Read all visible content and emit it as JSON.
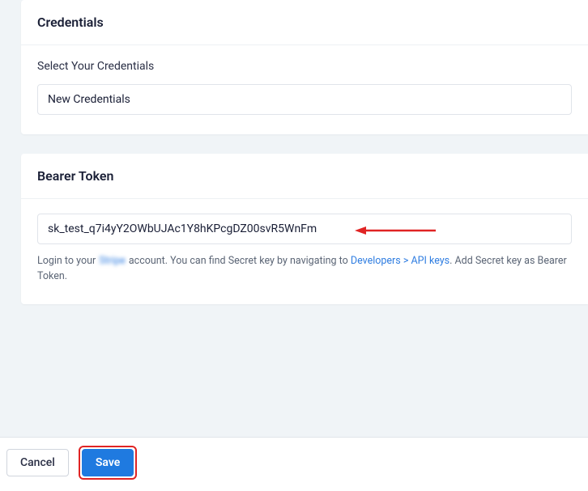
{
  "credentials": {
    "title": "Credentials",
    "label": "Select Your Credentials",
    "selected": "New Credentials"
  },
  "bearer": {
    "title": "Bearer Token",
    "value": "sk_test_q7i4yY2OWbUJAc1Y8hKPcgDZ00svR5WnFm",
    "help_prefix": "Login to your ",
    "help_blurred": "Stripe",
    "help_mid": " account. You can find Secret key by navigating to ",
    "help_link": "Developers > API keys",
    "help_suffix": ". Add Secret key as Bearer Token."
  },
  "footer": {
    "cancel": "Cancel",
    "save": "Save"
  },
  "colors": {
    "accent": "#1f7ae0",
    "annotation": "#e02424"
  }
}
